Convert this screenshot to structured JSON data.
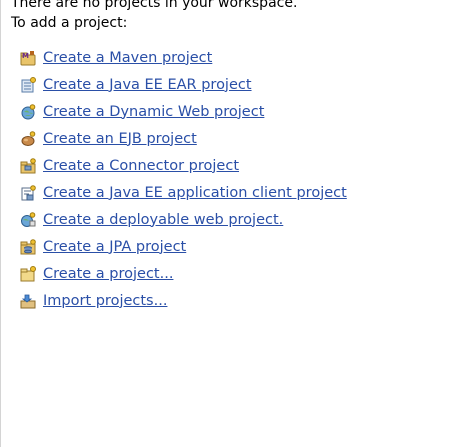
{
  "message": {
    "line1": "There are no projects in your workspace.",
    "line2": "To add a project:"
  },
  "actions": [
    {
      "label": "Create a Maven project",
      "icon": "maven-project-icon"
    },
    {
      "label": "Create a Java EE EAR project",
      "icon": "ear-project-icon"
    },
    {
      "label": "Create a Dynamic Web project",
      "icon": "dynamic-web-project-icon"
    },
    {
      "label": "Create an EJB project",
      "icon": "ejb-project-icon"
    },
    {
      "label": "Create a Connector project",
      "icon": "connector-project-icon"
    },
    {
      "label": "Create a Java EE application client project",
      "icon": "app-client-project-icon"
    },
    {
      "label": "Create a deployable web project.",
      "icon": "deployable-web-project-icon"
    },
    {
      "label": "Create a JPA project",
      "icon": "jpa-project-icon"
    },
    {
      "label": "Create a project...",
      "icon": "new-project-icon"
    },
    {
      "label": "Import projects...",
      "icon": "import-projects-icon"
    }
  ],
  "colors": {
    "link": "#2a4fa7",
    "text": "#000000",
    "background": "#ffffff"
  }
}
